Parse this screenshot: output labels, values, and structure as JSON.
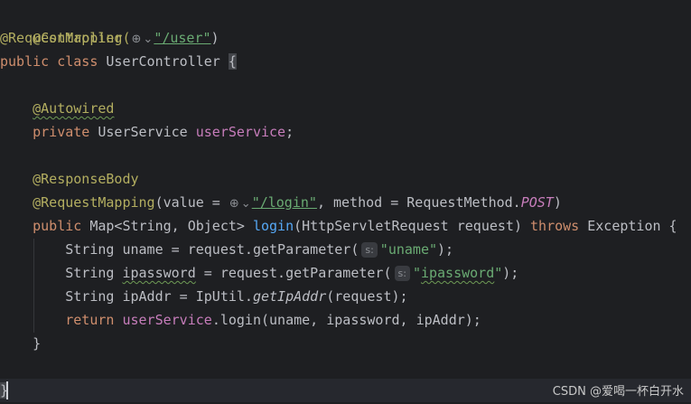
{
  "editor": {
    "ann_controller": "@Controller",
    "ann_reqmap_class": "@RequestMapping(",
    "globe_icon": "⊕",
    "chevron_icon": "⌄",
    "class_path": "\"/user\"",
    "close_paren": ")",
    "kw_public": "public",
    "kw_class": "class",
    "class_name": "UserController",
    "open_brace": "{",
    "ann_autowired": "@Autowired",
    "kw_private": "private",
    "field_type": "UserService",
    "field_name": "userService",
    "semicolon": ";",
    "ann_responsebody": "@ResponseBody",
    "ann_reqmap_method": "@RequestMapping",
    "value_prefix": "(value = ",
    "login_path": "\"/login\"",
    "method_mid": ", method = RequestMethod.",
    "method_post": "POST",
    "return_type": "Map<String, Object>",
    "method_name": "login",
    "params": "(HttpServletRequest request)",
    "kw_throws": "throws",
    "exception": "Exception {",
    "uname_decl": "String uname = request.getParameter(",
    "inlay_s": "s:",
    "uname_str": "\"uname\"",
    "close_stmt": ");",
    "ipwd_type": "String ",
    "ipwd_var": "ipassword",
    "ipwd_rest": " = request.getParameter(",
    "ipwd_str_q1": "\"",
    "ipwd_str_body": "ipassword",
    "ipwd_str_q2": "\"",
    "ipaddr_decl": "String ipAddr = IpUtil.",
    "ipaddr_method": "getIpAddr",
    "ipaddr_args": "(request);",
    "kw_return": "return",
    "return_field": "userService",
    "return_rest": ".login(uname, ipassword, ipAddr);",
    "method_close": "}",
    "class_close": "}"
  },
  "watermark": "CSDN @爱喝一杯白开水"
}
